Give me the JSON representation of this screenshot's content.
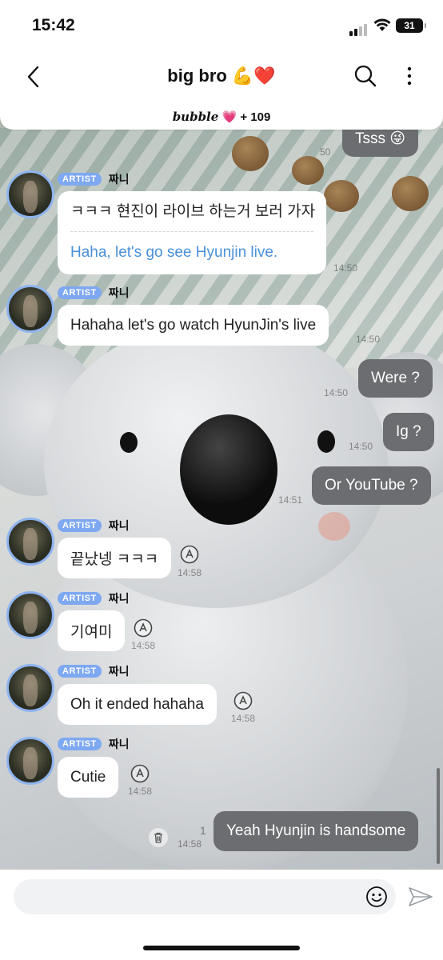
{
  "status_bar": {
    "time": "15:42",
    "battery": "31"
  },
  "header": {
    "title": "big bro 💪❤️",
    "brand": "bubble",
    "heart": "💗",
    "count": "+ 109"
  },
  "messages": [
    {
      "type": "mine",
      "text": "Tsss  😜"
    },
    {
      "type": "artist",
      "badge": "ARTIST",
      "name": "짜니",
      "text": "ㅋㅋㅋ 현진이 라이브 하는거 보러 가자",
      "translation": "Haha, let's go see Hyunjin live.",
      "time": "14:50"
    },
    {
      "type": "artist",
      "badge": "ARTIST",
      "name": "짜니",
      "text": "Hahaha let's go watch HyunJin's live",
      "time": "14:50"
    },
    {
      "type": "mine",
      "text": "Were ?",
      "time": "14:50"
    },
    {
      "type": "mine",
      "text": "Ig ?",
      "time": "14:50"
    },
    {
      "type": "mine",
      "text": "Or YouTube ?",
      "time": "14:51"
    },
    {
      "type": "artist",
      "badge": "ARTIST",
      "name": "짜니",
      "text": "끝났넹 ㅋㅋㅋ",
      "time": "14:58"
    },
    {
      "type": "artist",
      "badge": "ARTIST",
      "name": "짜니",
      "text": "기여미",
      "time": "14:58"
    },
    {
      "type": "artist",
      "badge": "ARTIST",
      "name": "짜니",
      "text": "Oh it ended hahaha",
      "time": "14:58"
    },
    {
      "type": "artist",
      "badge": "ARTIST",
      "name": "짜니",
      "text": "Cutie",
      "time": "14:58"
    },
    {
      "type": "mine",
      "text": "Yeah Hyunjin is handsome",
      "time": "14:58",
      "unread": "1"
    }
  ],
  "hidden_time": "50",
  "colors": {
    "artist_badge": "#7ea8f2",
    "my_bubble": "#6b6d70",
    "translation": "#4a90d9"
  },
  "icons": [
    "back-arrow-icon",
    "search-icon",
    "more-icon",
    "translate-icon",
    "trash-icon",
    "emoji-icon",
    "send-icon"
  ]
}
